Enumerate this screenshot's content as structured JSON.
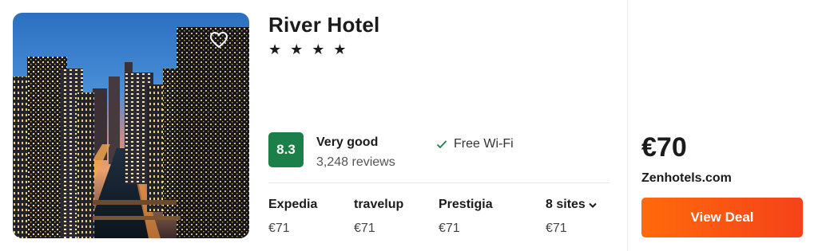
{
  "hotel": {
    "name": "River Hotel",
    "stars": "★ ★ ★ ★",
    "star_count": 4,
    "favorite_icon": "heart-outline-icon"
  },
  "rating": {
    "score": "8.3",
    "label": "Very good",
    "reviews": "3,248 reviews",
    "badge_color": "#1a7f48"
  },
  "amenity": {
    "label": "Free Wi-Fi",
    "icon": "check-icon",
    "icon_color": "#1a7f48"
  },
  "sites": [
    {
      "name": "Expedia",
      "price": "€71"
    },
    {
      "name": "travelup",
      "price": "€71"
    },
    {
      "name": "Prestigia",
      "price": "€71"
    }
  ],
  "more_sites": {
    "label": "8 sites",
    "price": "€71",
    "icon": "chevron-down-icon"
  },
  "deal": {
    "price": "€70",
    "provider": "Zenhotels.com",
    "button_label": "View Deal",
    "button_color": "#ff5a14"
  }
}
